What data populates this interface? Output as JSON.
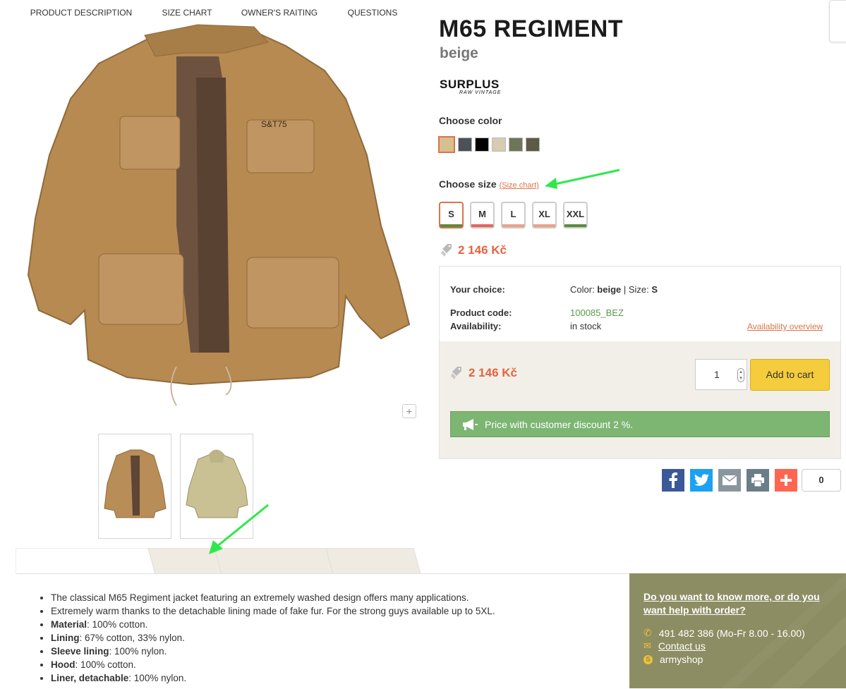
{
  "product": {
    "title": "M65 REGIMENT",
    "subtitle": "beige",
    "brand": "SURPLUS",
    "brand_tagline": "RAW VINTAGE"
  },
  "colors": {
    "label": "Choose color",
    "options": [
      {
        "name": "beige",
        "hex": "#d6c08f",
        "selected": true
      },
      {
        "name": "washed-black-camo",
        "hex": "#4d5057"
      },
      {
        "name": "black",
        "hex": "#000000"
      },
      {
        "name": "desert-camo",
        "hex": "#d8cbb0"
      },
      {
        "name": "olive",
        "hex": "#6f7559"
      },
      {
        "name": "woodland-camo",
        "hex": "#5d5a45"
      }
    ]
  },
  "sizes": {
    "label": "Choose size",
    "size_chart_link": "(Size chart)",
    "options": [
      {
        "label": "S",
        "bar": "#5b8b3e",
        "selected": true
      },
      {
        "label": "M",
        "bar": "#e5645c"
      },
      {
        "label": "L",
        "bar": "#e9a286"
      },
      {
        "label": "XL",
        "bar": "#e9a286"
      },
      {
        "label": "XXL",
        "bar": "#5b8b3e"
      }
    ]
  },
  "price": "2 146 Kč",
  "choice": {
    "your_choice_label": "Your choice:",
    "color_prefix": "Color: ",
    "color_value": "beige",
    "size_sep": " | Size: ",
    "size_value": "S",
    "product_code_label": "Product code:",
    "product_code": "100085_BEZ",
    "availability_label": "Availability:",
    "availability": "in stock",
    "availability_link": "Availability overview"
  },
  "cart": {
    "quantity": "1",
    "add_to_cart": "Add to cart",
    "discount_text": "Price with customer discount 2 %."
  },
  "share": {
    "count": "0"
  },
  "zoom_label": "+",
  "tabs": [
    {
      "label": "PRODUCT DESCRIPTION",
      "active": true
    },
    {
      "label": "SIZE CHART"
    },
    {
      "label": "OWNER'S RAITING"
    },
    {
      "label": "QUESTIONS"
    }
  ],
  "description": {
    "line1": "The classical M65 Regiment jacket featuring an extremely washed design offers many applications.",
    "line2": "Extremely warm thanks to the detachable lining made of fake fur. For the strong guys available up to 5XL.",
    "items": [
      {
        "key": "Material",
        "value": ": 100% cotton."
      },
      {
        "key": "Lining",
        "value": ": 67% cotton, 33% nylon."
      },
      {
        "key": "Sleeve lining",
        "value": ": 100% nylon."
      },
      {
        "key": "Hood",
        "value": ": 100% cotton."
      },
      {
        "key": "Liner, detachable",
        "value": ": 100% nylon."
      }
    ]
  },
  "help": {
    "question": "Do you want to know more, or do you want help with order?",
    "phone": "491 482 386 (Mo-Fr 8.00 - 16.00)",
    "contact": "Contact us",
    "skype": "armyshop"
  }
}
